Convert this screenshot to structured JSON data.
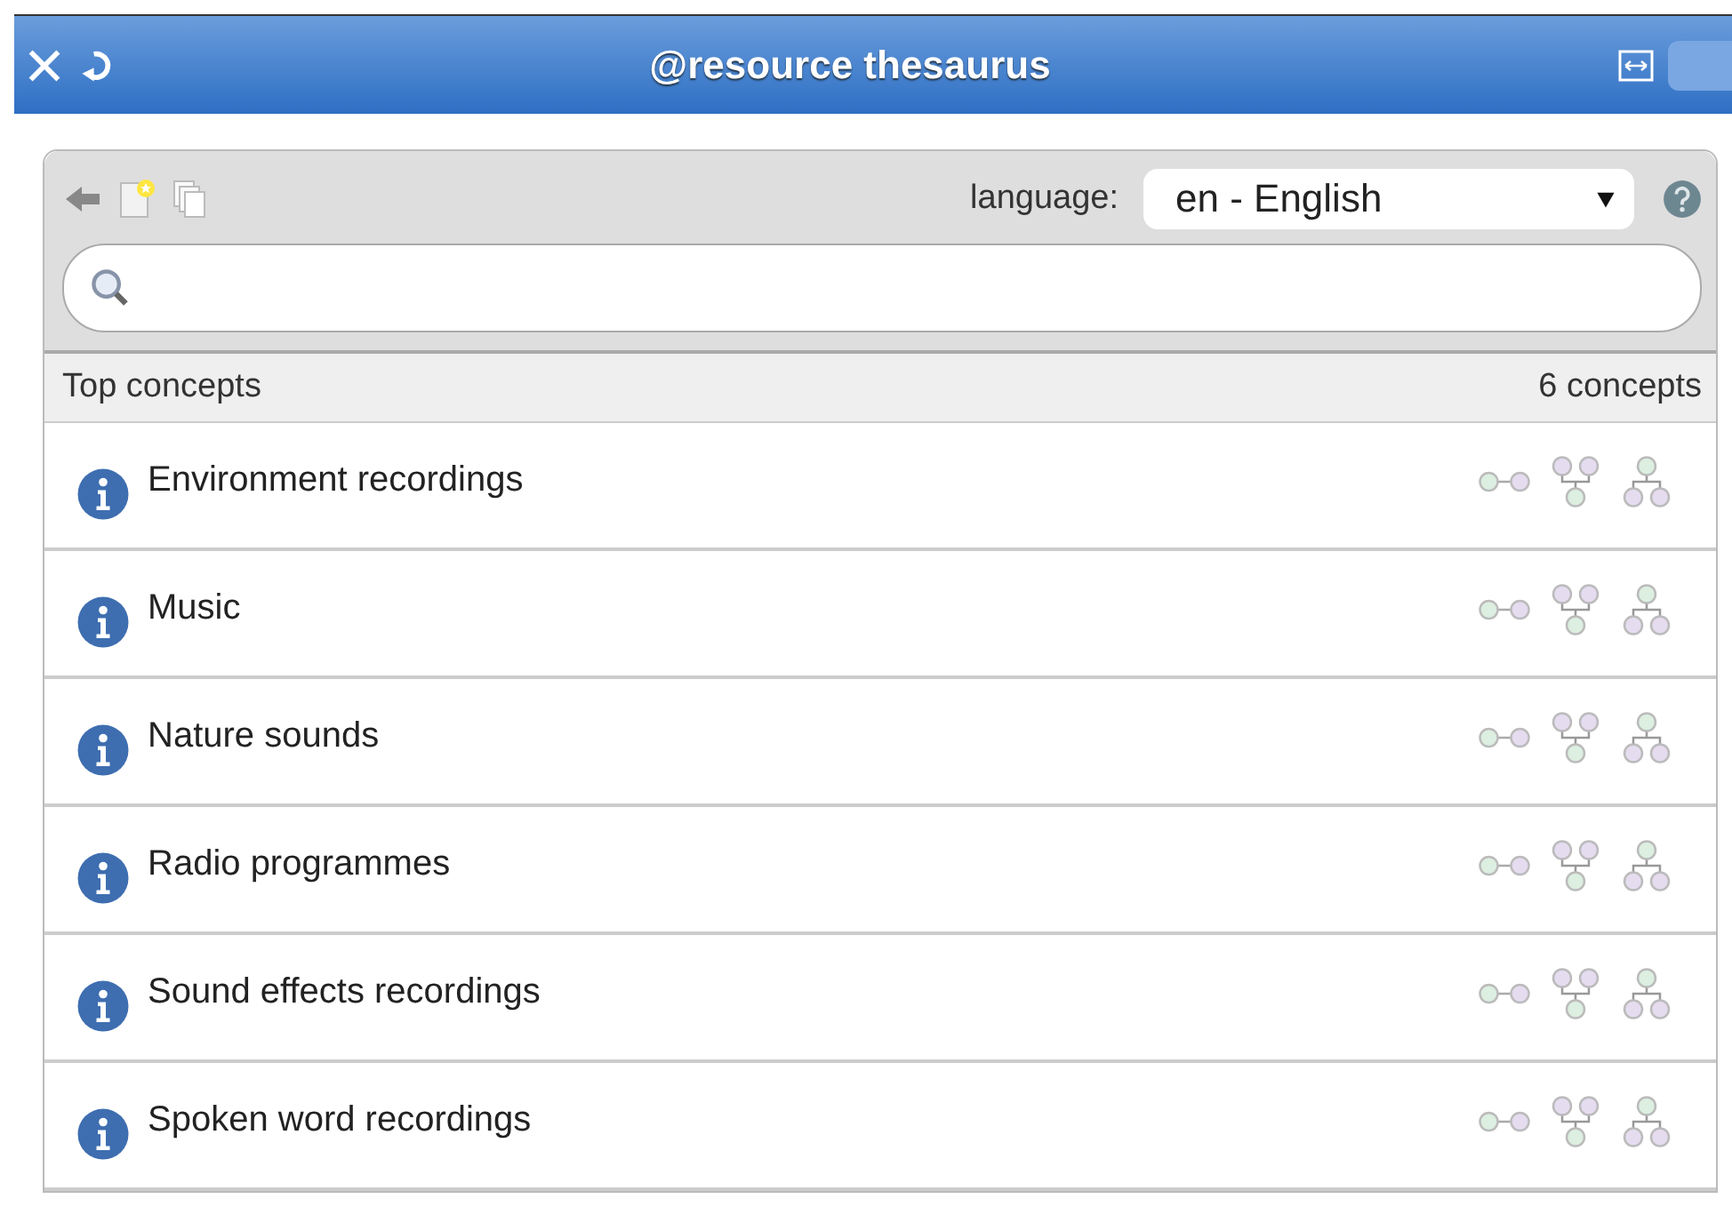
{
  "window": {
    "title": "@resource thesaurus"
  },
  "toolbar": {
    "language_label": "language:",
    "language_value": "en - English"
  },
  "list_header": {
    "title": "Top concepts",
    "count": "6 concepts"
  },
  "concepts": [
    {
      "label": "Environment recordings"
    },
    {
      "label": "Music"
    },
    {
      "label": "Nature sounds"
    },
    {
      "label": "Radio programmes"
    },
    {
      "label": "Sound effects recordings"
    },
    {
      "label": "Spoken word recordings"
    }
  ]
}
